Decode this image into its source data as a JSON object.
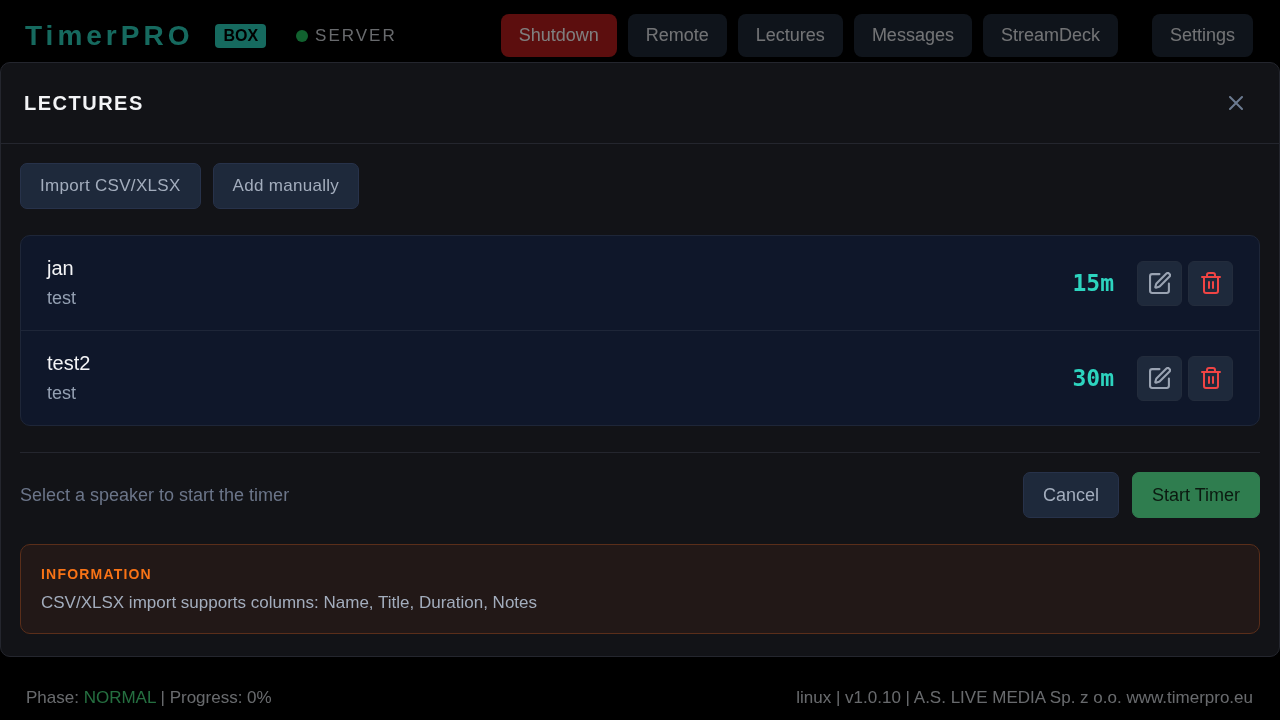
{
  "header": {
    "logo": "TimerPRO",
    "badge": "BOX",
    "status": {
      "label": "SERVER",
      "connected": true
    },
    "nav": [
      {
        "label": "Shutdown",
        "kind": "danger"
      },
      {
        "label": "Remote",
        "kind": "default"
      },
      {
        "label": "Lectures",
        "kind": "default"
      },
      {
        "label": "Messages",
        "kind": "default"
      },
      {
        "label": "StreamDeck",
        "kind": "default"
      }
    ],
    "settings": "Settings"
  },
  "dialog": {
    "title": "LECTURES",
    "toolbar_buttons": [
      "Import CSV/XLSX",
      "Add manually"
    ],
    "lectures": [
      {
        "name": "jan",
        "title": "test",
        "duration": "15m"
      },
      {
        "name": "test2",
        "title": "test",
        "duration": "30m"
      }
    ],
    "hint": "Select a speaker to start the timer",
    "buttons": [
      {
        "label": "Cancel",
        "kind": "secondary"
      },
      {
        "label": "Start Timer",
        "kind": "primary"
      }
    ],
    "info": {
      "heading": "INFORMATION",
      "text": "CSV/XLSX import supports columns: Name, Title, Duration, Notes"
    }
  },
  "footer": {
    "phase_label": "Phase:",
    "phase": "NORMAL",
    "progress": "| Progress: 0%",
    "about": "linux | v1.0.10 | A.S. LIVE MEDIA Sp. z o.o. www.timerpro.eu"
  }
}
